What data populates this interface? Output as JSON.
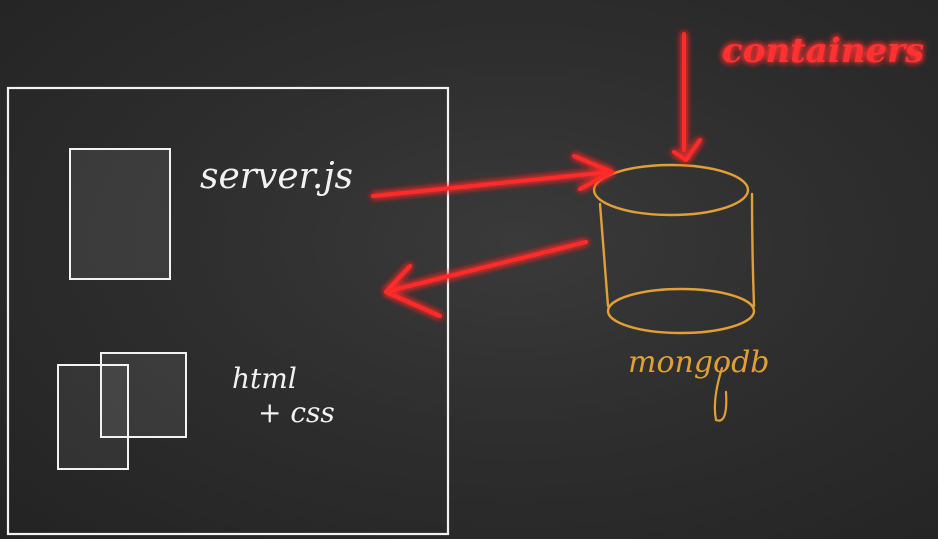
{
  "labels": {
    "server": "server.js",
    "html_line1": "html",
    "html_line2": "+ css",
    "db": "mongodb",
    "containers": "containers"
  },
  "colors": {
    "background": "#2b2b2b",
    "chalk": "#f2f2f2",
    "db": "#e0a035",
    "neon": "#ff2a2a",
    "neon_glow": "#ff0000"
  }
}
